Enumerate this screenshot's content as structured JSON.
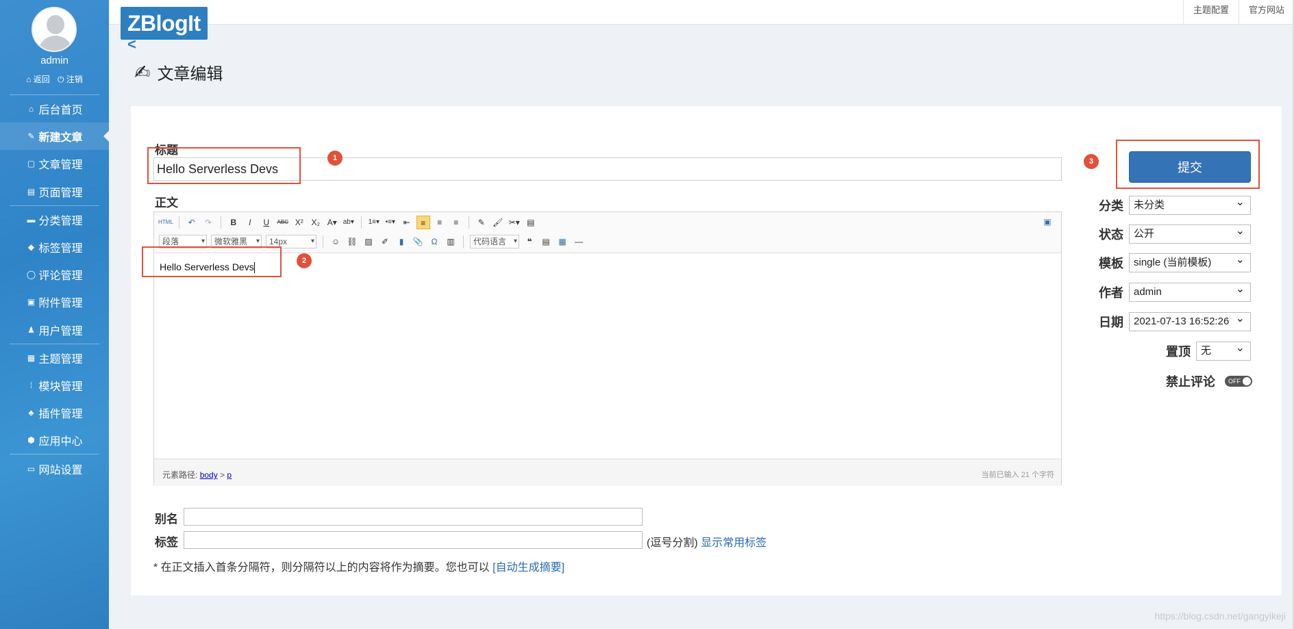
{
  "sidebar": {
    "username": "admin",
    "back_label": "⌂ 返回",
    "logout_label": "⏻ 注销",
    "items": [
      {
        "icon": "⌂",
        "label": "后台首页"
      },
      {
        "icon": "✎",
        "label": "新建文章"
      },
      {
        "icon": "▢",
        "label": "文章管理"
      },
      {
        "icon": "▤",
        "label": "页面管理"
      },
      {
        "icon": "▬",
        "label": "分类管理"
      },
      {
        "icon": "◆",
        "label": "标签管理"
      },
      {
        "icon": "◯",
        "label": "评论管理"
      },
      {
        "icon": "▣",
        "label": "附件管理"
      },
      {
        "icon": "♟",
        "label": "用户管理"
      },
      {
        "icon": "▦",
        "label": "主题管理"
      },
      {
        "icon": "⁞",
        "label": "模块管理"
      },
      {
        "icon": "♣",
        "label": "插件管理"
      },
      {
        "icon": "⬢",
        "label": "应用中心"
      },
      {
        "icon": "▭",
        "label": "网站设置"
      }
    ]
  },
  "topbar": {
    "theme_config": "主题配置",
    "official_site": "官方网站"
  },
  "logo": "ZBlogIt",
  "page_title": "文章编辑",
  "form": {
    "title_label": "标题",
    "title_value": "Hello Serverless Devs",
    "body_label": "正文",
    "body_text": "Hello Serverless Devs",
    "submit": "提交",
    "category_label": "分类",
    "category_value": "未分类",
    "status_label": "状态",
    "status_value": "公开",
    "template_label": "模板",
    "template_value": "single (当前模板)",
    "author_label": "作者",
    "author_value": "admin",
    "date_label": "日期",
    "date_value": "2021-07-13 16:52:26",
    "sticky_label": "置顶",
    "sticky_value": "无",
    "nocomment_label": "禁止评论",
    "nocomment_toggle": "OFF",
    "alias_label": "别名",
    "tags_label": "标签",
    "tags_hint": "(逗号分割)",
    "show_common_tags": "显示常用标签",
    "excerpt_hint": "* 在正文插入首条分隔符，则分隔符以上的内容将作为摘要。您也可以",
    "auto_excerpt": "[自动生成摘要]"
  },
  "editor": {
    "toolbar_row1": [
      "HTML",
      "↶",
      "↷",
      "B",
      "I",
      "U",
      "ABC",
      "X²",
      "X₂",
      "A▾",
      "ab▾",
      "1≡▾",
      "•≡▾",
      "⇤",
      "≡",
      "≡",
      "≡",
      "✎",
      "🖌",
      "✂▾",
      "▤"
    ],
    "paragraph_select": "段落",
    "font_select": "微软雅黑",
    "size_select": "14px",
    "code_select": "代码语言",
    "path_label": "元素路径:",
    "path_body": "body",
    "path_sep": ">",
    "path_p": "p",
    "char_count": "当前已输入 21 个字符"
  },
  "annotations": [
    "1",
    "2",
    "3"
  ],
  "watermark": "https://blog.csdn.net/gangyikeji",
  "colors": {
    "sidebar": "#2f84c8",
    "accent": "#3573b7",
    "annotation": "#e0513a"
  }
}
